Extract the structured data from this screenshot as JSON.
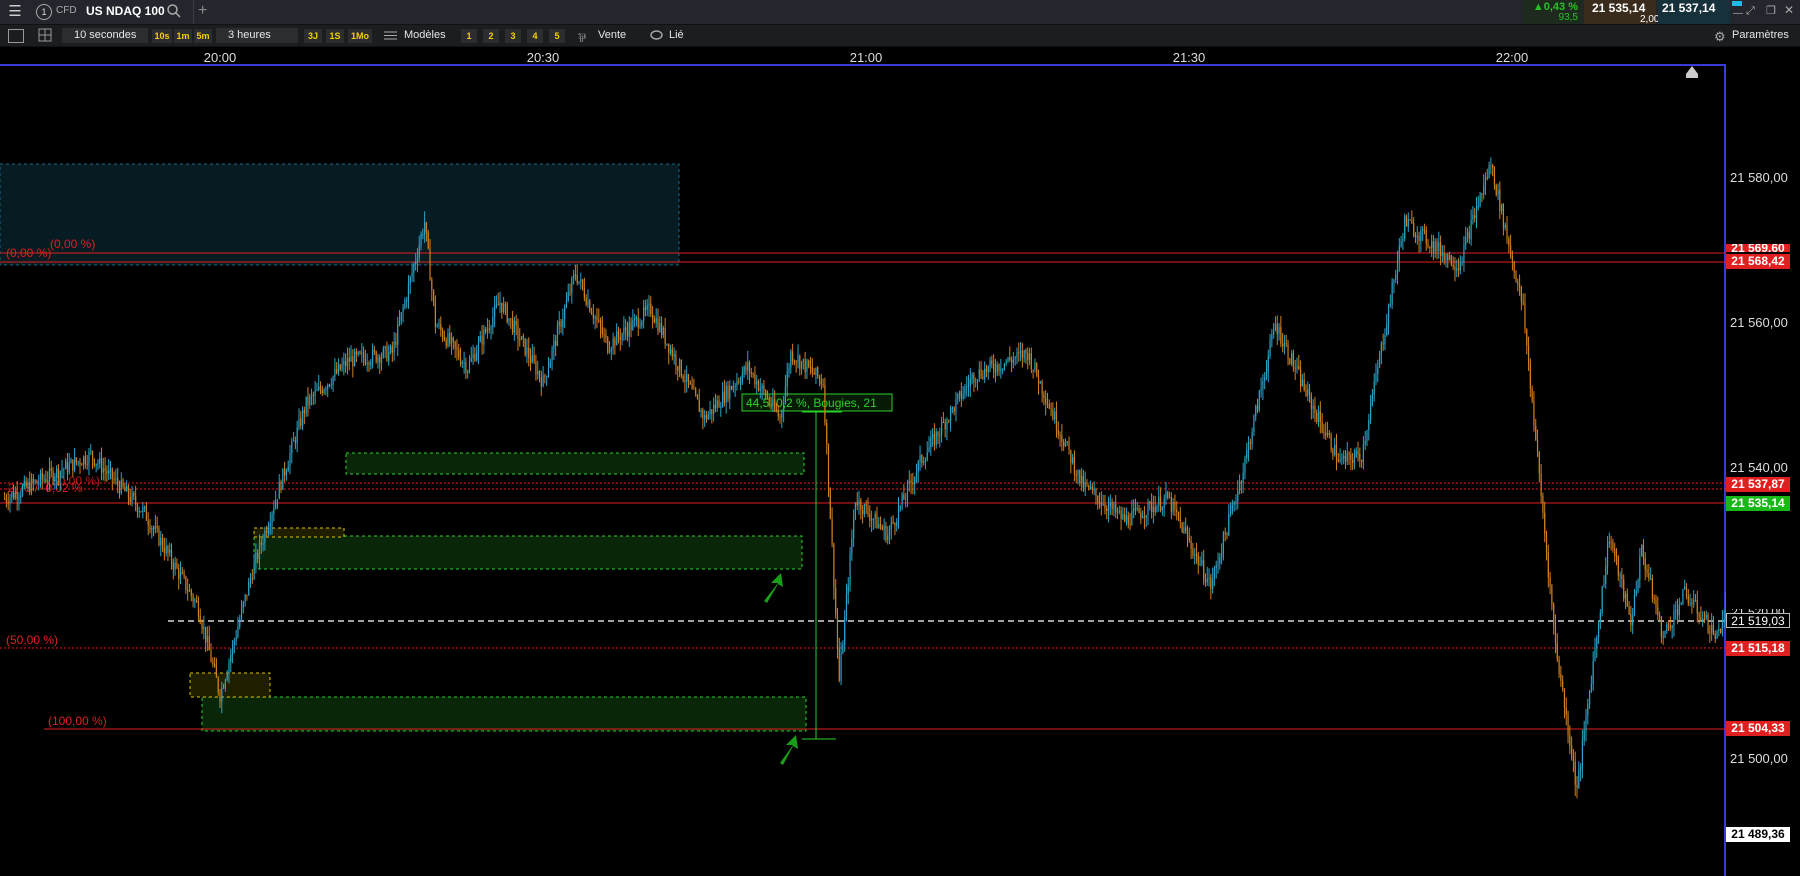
{
  "header": {
    "menu_icon": "hamburger-icon",
    "tab_number": "1",
    "tab_badge": "CFD",
    "instrument": "US NDAQ 100",
    "add_tab": "+",
    "change_pct": "0,43 %",
    "change_pts": "93,5",
    "bid": "21 535,14",
    "spread": "2,00",
    "ask": "21 537,14"
  },
  "toolbar": {
    "interval": "10 secondes",
    "quick_intervals": [
      "10s",
      "1m",
      "5m"
    ],
    "range": "3 heures",
    "quick_ranges": [
      "3J",
      "1S",
      "1Mo"
    ],
    "models_label": "Modèles",
    "slots": [
      "1",
      "2",
      "3",
      "4",
      "5"
    ],
    "sell_label": "Vente",
    "link_label": "Lié",
    "settings_label": "Paramètres"
  },
  "time_axis": [
    "20:00",
    "20:30",
    "21:00",
    "21:30",
    "22:00"
  ],
  "price_axis": {
    "ticks": [
      "21 580,00",
      "21 560,00",
      "21 540,00",
      "21 500,00"
    ],
    "boxes": {
      "high_hidden": "21 569,60",
      "fib0": "21 568,42",
      "ask": "21 537,87",
      "bid": "21 535,14",
      "hidden_520": "21 520,00",
      "crosshair": "21 519,03",
      "fib50": "21 515,18",
      "fib100": "21 504,33",
      "low": "21 489,36"
    }
  },
  "annotations": {
    "fib0_left": "(0,00 %)",
    "fib0_inner": "(0,00 %)",
    "fib_mid": "-2,73 / -0,02 %",
    "fib_mid_b": "(50,00 %)",
    "fib50": "(50,00 %)",
    "fib100": "(100,00 %)",
    "measure": "44,5, 0,2 %, Bougies, 21"
  },
  "colors": {
    "up": "#2aa3c7",
    "down": "#d0801e",
    "fib_red": "#e02020",
    "zone_green": "#2bd12b",
    "zone_yellow": "#e0c000",
    "bid_green": "#18b818",
    "ask_red": "#e02020",
    "accent_blue": "#3a3ad8"
  },
  "chart_data": {
    "type": "candlestick",
    "title": "US NDAQ 100",
    "interval": "10 secondes",
    "ylim": [
      21480,
      21600
    ],
    "y_ticks": [
      21500,
      21540,
      21560,
      21580
    ],
    "x_ticks": [
      "20:00",
      "20:30",
      "21:00",
      "21:30",
      "22:00"
    ],
    "path_times_min": [
      -20,
      -12,
      -7,
      -2,
      0,
      3,
      8,
      12,
      16,
      19,
      20,
      23,
      26,
      30,
      33,
      36,
      40,
      45,
      49,
      52,
      53,
      56,
      57.5,
      59,
      62,
      65,
      70,
      75,
      80,
      84,
      88,
      92,
      95,
      98,
      101,
      104,
      106,
      110,
      115,
      118,
      121,
      124,
      126,
      129,
      131,
      132,
      133,
      134,
      136,
      139,
      142,
      144,
      147,
      149,
      151
    ],
    "path_prices": [
      21530,
      21536,
      21528,
      21515,
      21503,
      21520,
      21543,
      21549,
      21550,
      21568,
      21554,
      21548,
      21557,
      21546,
      21561,
      21551,
      21556,
      21541,
      21548,
      21541,
      21550,
      21546,
      21505,
      21530,
      21525,
      21535,
      21547,
      21550,
      21532,
      21527,
      21530,
      21518,
      21534,
      21554,
      21544,
      21535,
      21536,
      21568,
      21562,
      21576,
      21556,
      21510,
      21490,
      21525,
      21513,
      21523,
      21517,
      21511,
      21517,
      21511,
      21525,
      21538,
      21520,
      21530,
      21535
    ],
    "fib_levels": [
      {
        "label": "0,00 %",
        "price": 21568.42
      },
      {
        "label": "50,00 %",
        "price": 21515.18
      },
      {
        "label": "100,00 %",
        "price": 21504.33
      }
    ],
    "last_bid": 21535.14,
    "last_ask": 21537.87,
    "crosshair": 21519.03,
    "session_high": 21586,
    "session_low": 21489.36
  }
}
